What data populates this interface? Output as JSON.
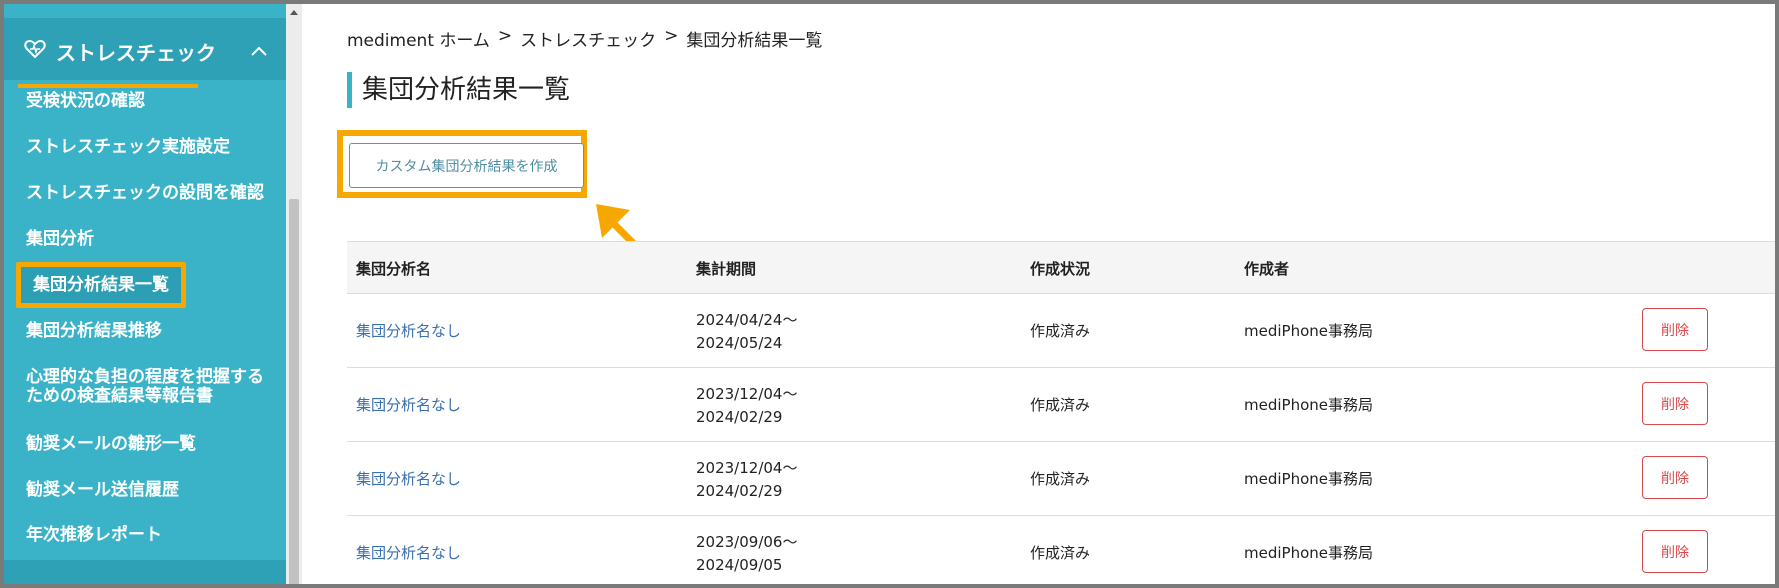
{
  "sidebar": {
    "section_title": "ストレスチェック",
    "items": [
      {
        "label": "受検状況の確認"
      },
      {
        "label": "ストレスチェック実施設定"
      },
      {
        "label": "ストレスチェックの設問を確認"
      },
      {
        "label": "集団分析"
      },
      {
        "label": "集団分析結果一覧"
      },
      {
        "label": "集団分析結果推移"
      },
      {
        "label": "心理的な負担の程度を把握する"
      },
      {
        "label": "ための検査結果等報告書"
      },
      {
        "label": "勧奨メールの雛形一覧"
      },
      {
        "label": "勧奨メール送信履歴"
      },
      {
        "label": "年次推移レポート"
      }
    ],
    "active_item": "集団分析結果一覧"
  },
  "breadcrumb": {
    "home": "mediment ホーム",
    "section": "ストレスチェック",
    "current": "集団分析結果一覧",
    "separator": ">"
  },
  "page_title": "集団分析結果一覧",
  "create_button_label": "カスタム集団分析結果を作成",
  "table": {
    "headers": {
      "name": "集団分析名",
      "period": "集計期間",
      "status": "作成状況",
      "author": "作成者"
    },
    "rows": [
      {
        "name": "集団分析名なし",
        "period_start": "2024/04/24～",
        "period_end": "2024/05/24",
        "status": "作成済み",
        "author": "mediPhone事務局",
        "delete_label": "削除"
      },
      {
        "name": "集団分析名なし",
        "period_start": "2023/12/04～",
        "period_end": "2024/02/29",
        "status": "作成済み",
        "author": "mediPhone事務局",
        "delete_label": "削除"
      },
      {
        "name": "集団分析名なし",
        "period_start": "2023/12/04～",
        "period_end": "2024/02/29",
        "status": "作成済み",
        "author": "mediPhone事務局",
        "delete_label": "削除"
      },
      {
        "name": "集団分析名なし",
        "period_start": "2023/09/06～",
        "period_end": "2024/09/05",
        "status": "作成済み",
        "author": "mediPhone事務局",
        "delete_label": "削除"
      }
    ]
  },
  "colors": {
    "sidebar_bg": "#3ab3c8",
    "highlight": "#f7a800",
    "link": "#3a6fb0",
    "delete": "#d8494d"
  },
  "icons": {
    "section": "heart-icon",
    "collapse": "chevron-up-icon",
    "annotation": "arrow-icon"
  }
}
